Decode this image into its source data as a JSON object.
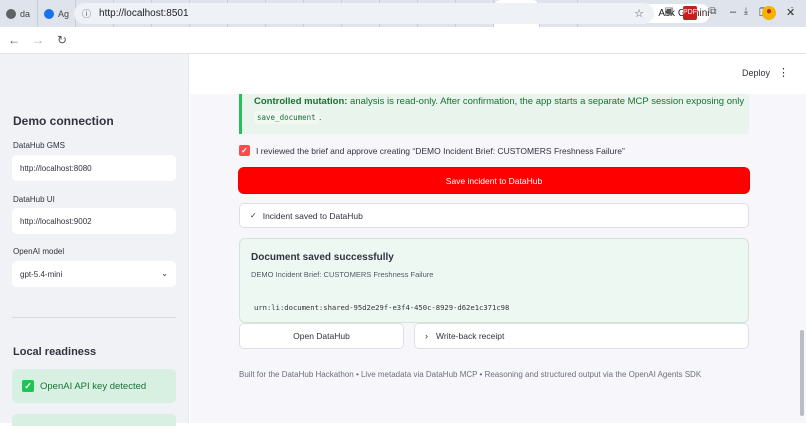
{
  "browser": {
    "tabs": [
      {
        "label": "da",
        "color": "#5f6368"
      },
      {
        "label": "Ag",
        "color": "#1a73e8"
      },
      {
        "label": "DI",
        "color": "#7b61ff"
      },
      {
        "label": "AF",
        "color": "#1a73e8"
      },
      {
        "label": "Da",
        "color": "#7b61ff"
      },
      {
        "label": "Se",
        "color": "#7b61ff"
      },
      {
        "label": "lo",
        "color": "#5f6368"
      },
      {
        "label": "Di",
        "color": "#202124"
      },
      {
        "label": "Dr",
        "color": "#e8710a"
      },
      {
        "label": "Bu",
        "color": "#ea4335"
      },
      {
        "label": "Al",
        "color": "#1a73e8"
      },
      {
        "label": "Us",
        "color": "#1a73e8"
      },
      {
        "label": "W",
        "color": "#ea4335"
      },
      {
        "label": "",
        "color": "#1a73e8",
        "active": true
      },
      {
        "label": "pu",
        "color": "#4285f4"
      }
    ],
    "new_tab": "+",
    "gemini": "Ask Gemini",
    "url": "http://localhost:8501",
    "window_min": "–",
    "window_max": "❐",
    "window_close": "✕"
  },
  "header": {
    "deploy": "Deploy",
    "menu": "⋮"
  },
  "sidebar": {
    "connection_title": "Demo connection",
    "gms_label": "DataHub GMS",
    "gms_value": "http://localhost:8080",
    "ui_label": "DataHub UI",
    "ui_value": "http://localhost:9002",
    "model_label": "OpenAI model",
    "model_value": "gpt-5.4-mini",
    "readiness_title": "Local readiness",
    "readiness_items": [
      "OpenAI API key detected"
    ]
  },
  "main": {
    "mutation_title": "Controlled mutation:",
    "mutation_text": "analysis is read-only. After confirmation, the app starts a separate MCP session exposing only",
    "mutation_code": "save_document",
    "mutation_end": ".",
    "ack_label": "I reviewed the brief and approve creating “DEMO Incident Brief: CUSTOMERS Freshness Failure”",
    "save_button": "Save incident to DataHub",
    "status_label": "Incident saved to DataHub",
    "saved_title": "Document saved successfully",
    "saved_subtitle": "DEMO Incident Brief: CUSTOMERS Freshness Failure",
    "saved_urn": "urn:li:document:shared-95d2e29f-e3f4-450c-8929-d62e1c371c98",
    "open_button": "Open DataHub",
    "receipt_label": "Write-back receipt",
    "footer": "Built for the DataHub Hackathon • Live metadata via DataHub MCP • Reasoning and structured output via the OpenAI Agents SDK"
  },
  "colors": {
    "primary": "#ff0000",
    "success_text": "#177233",
    "success_bg": "#e8f4ec"
  }
}
